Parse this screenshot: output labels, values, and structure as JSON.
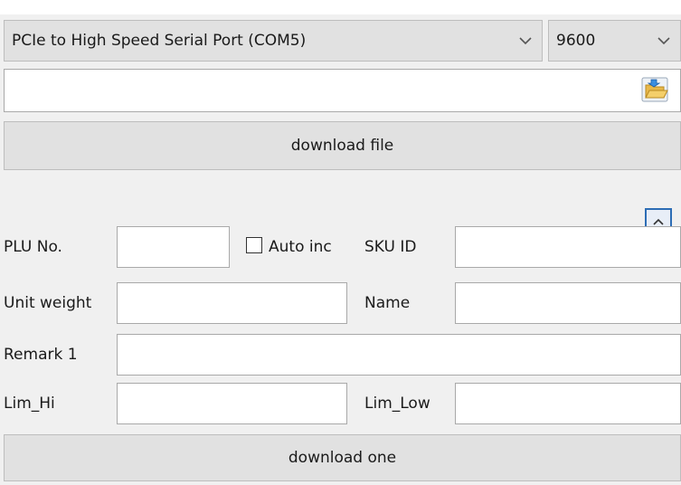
{
  "serial": {
    "port_value": "PCIe to High Speed Serial Port (COM5)",
    "baud_value": "9600"
  },
  "file": {
    "path_value": ""
  },
  "buttons": {
    "download_file": "download file",
    "download_one": "download one"
  },
  "form": {
    "plu_label": "PLU No.",
    "plu_value": "",
    "auto_inc_label": "Auto inc",
    "sku_label": "SKU ID",
    "sku_value": "",
    "unit_weight_label": "Unit weight",
    "unit_weight_value": "",
    "name_label": "Name",
    "name_value": "",
    "remark1_label": "Remark 1",
    "remark1_value": "",
    "lim_hi_label": "Lim_Hi",
    "lim_hi_value": "",
    "lim_low_label": "Lim_Low",
    "lim_low_value": ""
  },
  "icons": {
    "combo_arrow": "chevron-down-icon",
    "folder": "folder-open-icon",
    "collapse": "chevron-up-icon"
  },
  "colors": {
    "accent": "#2d6db5",
    "panel": "#f0f0f0",
    "button": "#e1e1e1"
  }
}
